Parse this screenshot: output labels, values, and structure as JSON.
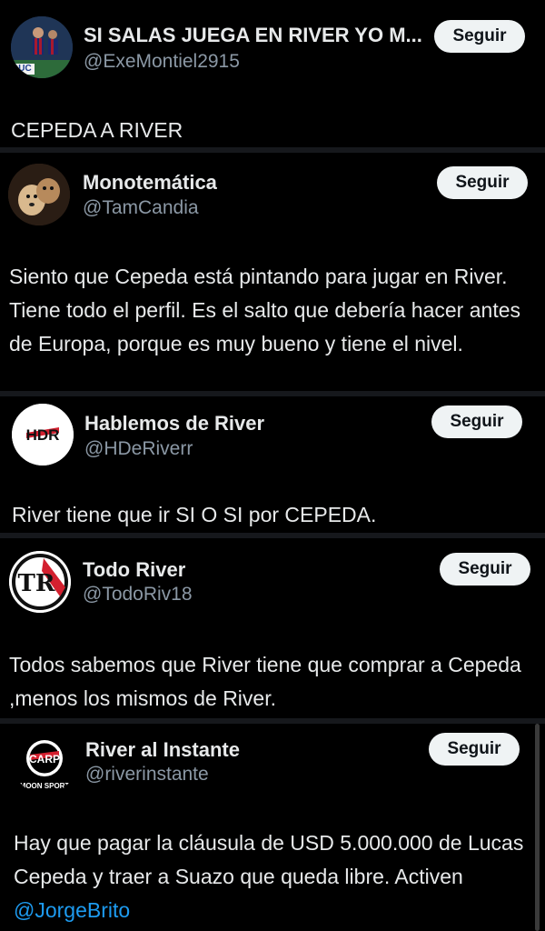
{
  "colors": {
    "background": "#000000",
    "text": "#e7e9ea",
    "handle": "#8b98a5",
    "mention": "#1d9bf0",
    "follow_bg": "#eff3f4",
    "follow_text": "#0f1419"
  },
  "tweets": [
    {
      "name": "SI SALAS JUEGA EN RIVER YO M...",
      "handle": "@ExeMontiel2915",
      "follow_label": "Seguir",
      "text": "CEPEDA A RIVER",
      "avatar_icon": "football-players-photo-icon",
      "avatar_text": "DUC"
    },
    {
      "name": "Monotemática",
      "handle": "@TamCandia",
      "follow_label": "Seguir",
      "text": "Siento que Cepeda está pintando para jugar en River. Tiene todo el perfil. Es el salto que debería hacer antes de Europa, porque es muy bueno y tiene el nivel.",
      "avatar_icon": "dogs-photo-icon"
    },
    {
      "name": "Hablemos de River",
      "handle": "@HDeRiverr",
      "follow_label": "Seguir",
      "text": "River tiene que ir SI O SI por CEPEDA.",
      "avatar_icon": "hdr-logo-icon",
      "avatar_text": "HDR"
    },
    {
      "name": "Todo River",
      "handle": "@TodoRiv18",
      "follow_label": "Seguir",
      "text": "Todos sabemos que River tiene que comprar a Cepeda ,menos los mismos de River.",
      "avatar_icon": "todo-river-logo-icon",
      "avatar_text": "TR"
    },
    {
      "name": "River al Instante",
      "handle": "@riverinstante",
      "follow_label": "Seguir",
      "text": "Hay que pagar la cláusula de USD 5.000.000 de Lucas Cepeda y traer a Suazo que queda libre. Activen",
      "mention": "@JorgeBrito",
      "avatar_icon": "carp-moon-sport-logo-icon",
      "avatar_text": "CARP",
      "avatar_subtext": "MOON SPORT"
    }
  ]
}
